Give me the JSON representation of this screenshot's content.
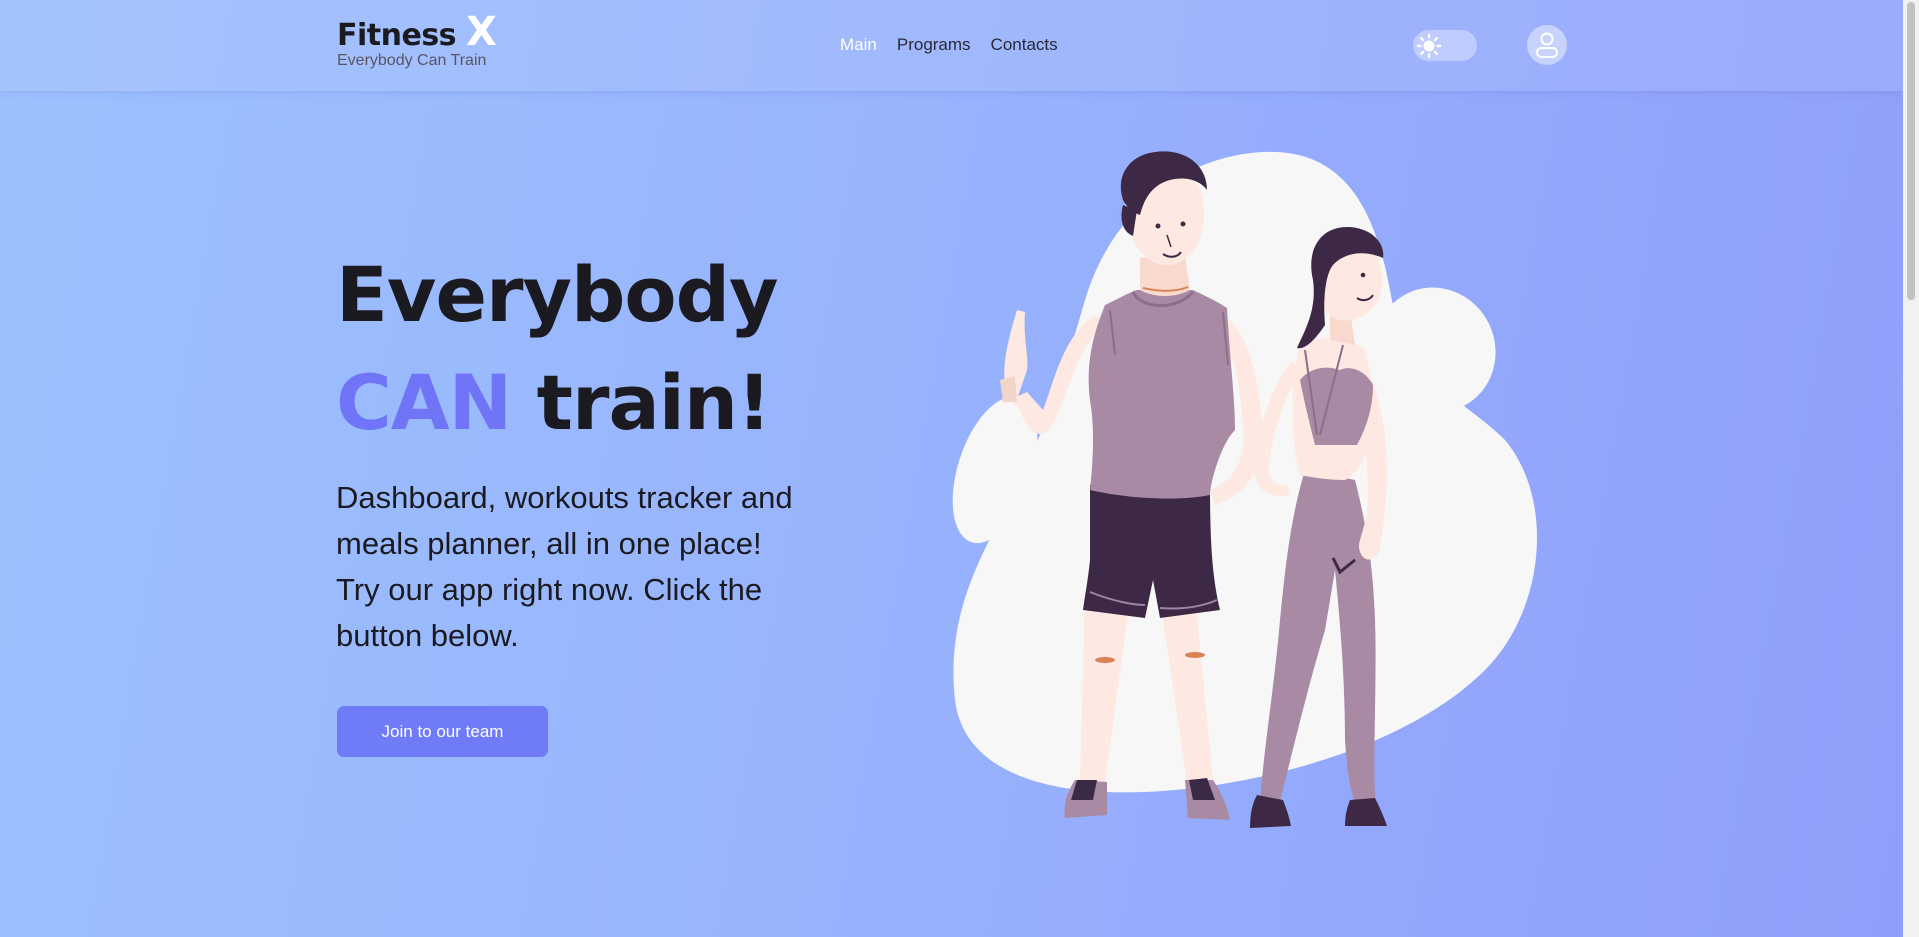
{
  "logo": {
    "name": "Fitness",
    "mark": "X",
    "tagline": "Everybody Can Train"
  },
  "nav": [
    {
      "label": "Main",
      "active": true
    },
    {
      "label": "Programs",
      "active": false
    },
    {
      "label": "Contacts",
      "active": false
    }
  ],
  "header": {
    "theme_icon": "sun-icon",
    "profile_icon": "user-icon"
  },
  "hero": {
    "title_line1": "Everybody",
    "title_accent": "CAN",
    "title_rest": "train!",
    "description": "Dashboard, workouts tracker and meals planner, all in one place! Try our app right now. Click the button below.",
    "cta_label": "Join to our team"
  },
  "colors": {
    "accent": "#6f75f6",
    "button": "#6f7bf7",
    "text": "#1c1a21"
  }
}
